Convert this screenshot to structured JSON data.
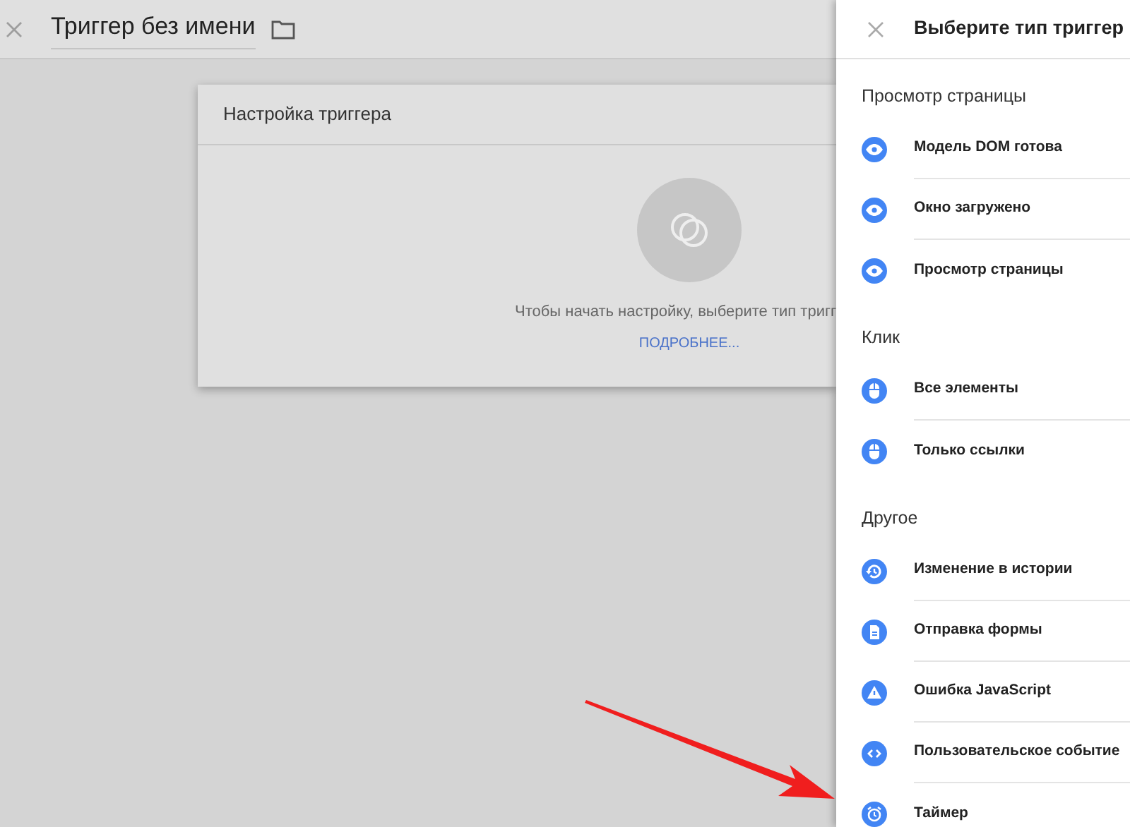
{
  "top_bar": {
    "title": "Триггер без имени"
  },
  "card": {
    "title": "Настройка триггера",
    "message": "Чтобы начать настройку, выберите тип тригг",
    "link": "ПОДРОБНЕЕ..."
  },
  "panel": {
    "title": "Выберите тип триггер",
    "sections": [
      {
        "heading": "Просмотр страницы",
        "items": [
          {
            "label": "Модель DOM готова",
            "kind": "page_view"
          },
          {
            "label": "Окно загружено",
            "kind": "page_view"
          },
          {
            "label": "Просмотр страницы",
            "kind": "page_view"
          }
        ]
      },
      {
        "heading": "Клик",
        "items": [
          {
            "label": "Все элементы",
            "kind": "click"
          },
          {
            "label": "Только ссылки",
            "kind": "click"
          }
        ]
      },
      {
        "heading": "Другое",
        "items": [
          {
            "label": "Изменение в истории",
            "kind": "history"
          },
          {
            "label": "Отправка формы",
            "kind": "form"
          },
          {
            "label": "Ошибка JavaScript",
            "kind": "error"
          },
          {
            "label": "Пользовательское событие",
            "kind": "custom_event"
          },
          {
            "label": "Таймер",
            "kind": "timer"
          }
        ]
      }
    ]
  }
}
